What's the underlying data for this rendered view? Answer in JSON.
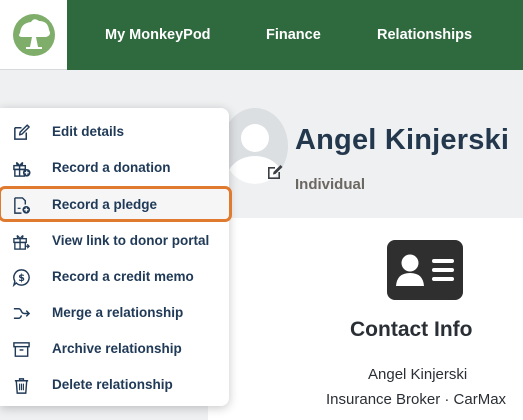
{
  "nav": {
    "items": [
      {
        "label": "My MonkeyPod"
      },
      {
        "label": "Finance"
      },
      {
        "label": "Relationships"
      }
    ]
  },
  "profile": {
    "name": "Angel Kinjerski",
    "type": "Individual"
  },
  "contact": {
    "title": "Contact Info",
    "name": "Angel Kinjerski",
    "job": "Insurance Broker · CarMax"
  },
  "menu": {
    "items": [
      {
        "label": "Edit details",
        "icon": "edit-icon"
      },
      {
        "label": "Record a donation",
        "icon": "gift-plus-icon"
      },
      {
        "label": "Record a pledge",
        "icon": "document-plus-icon",
        "highlighted": true
      },
      {
        "label": "View link to donor portal",
        "icon": "gift-link-icon"
      },
      {
        "label": "Record a credit memo",
        "icon": "dollar-bubble-icon"
      },
      {
        "label": "Merge a relationship",
        "icon": "merge-arrow-icon"
      },
      {
        "label": "Archive relationship",
        "icon": "archive-box-icon"
      },
      {
        "label": "Delete relationship",
        "icon": "trash-icon"
      }
    ]
  },
  "colors": {
    "nav_bg": "#2f6a3f",
    "menu_text": "#203a57",
    "highlight_border": "#e07a2e",
    "name_text": "#23384d"
  }
}
